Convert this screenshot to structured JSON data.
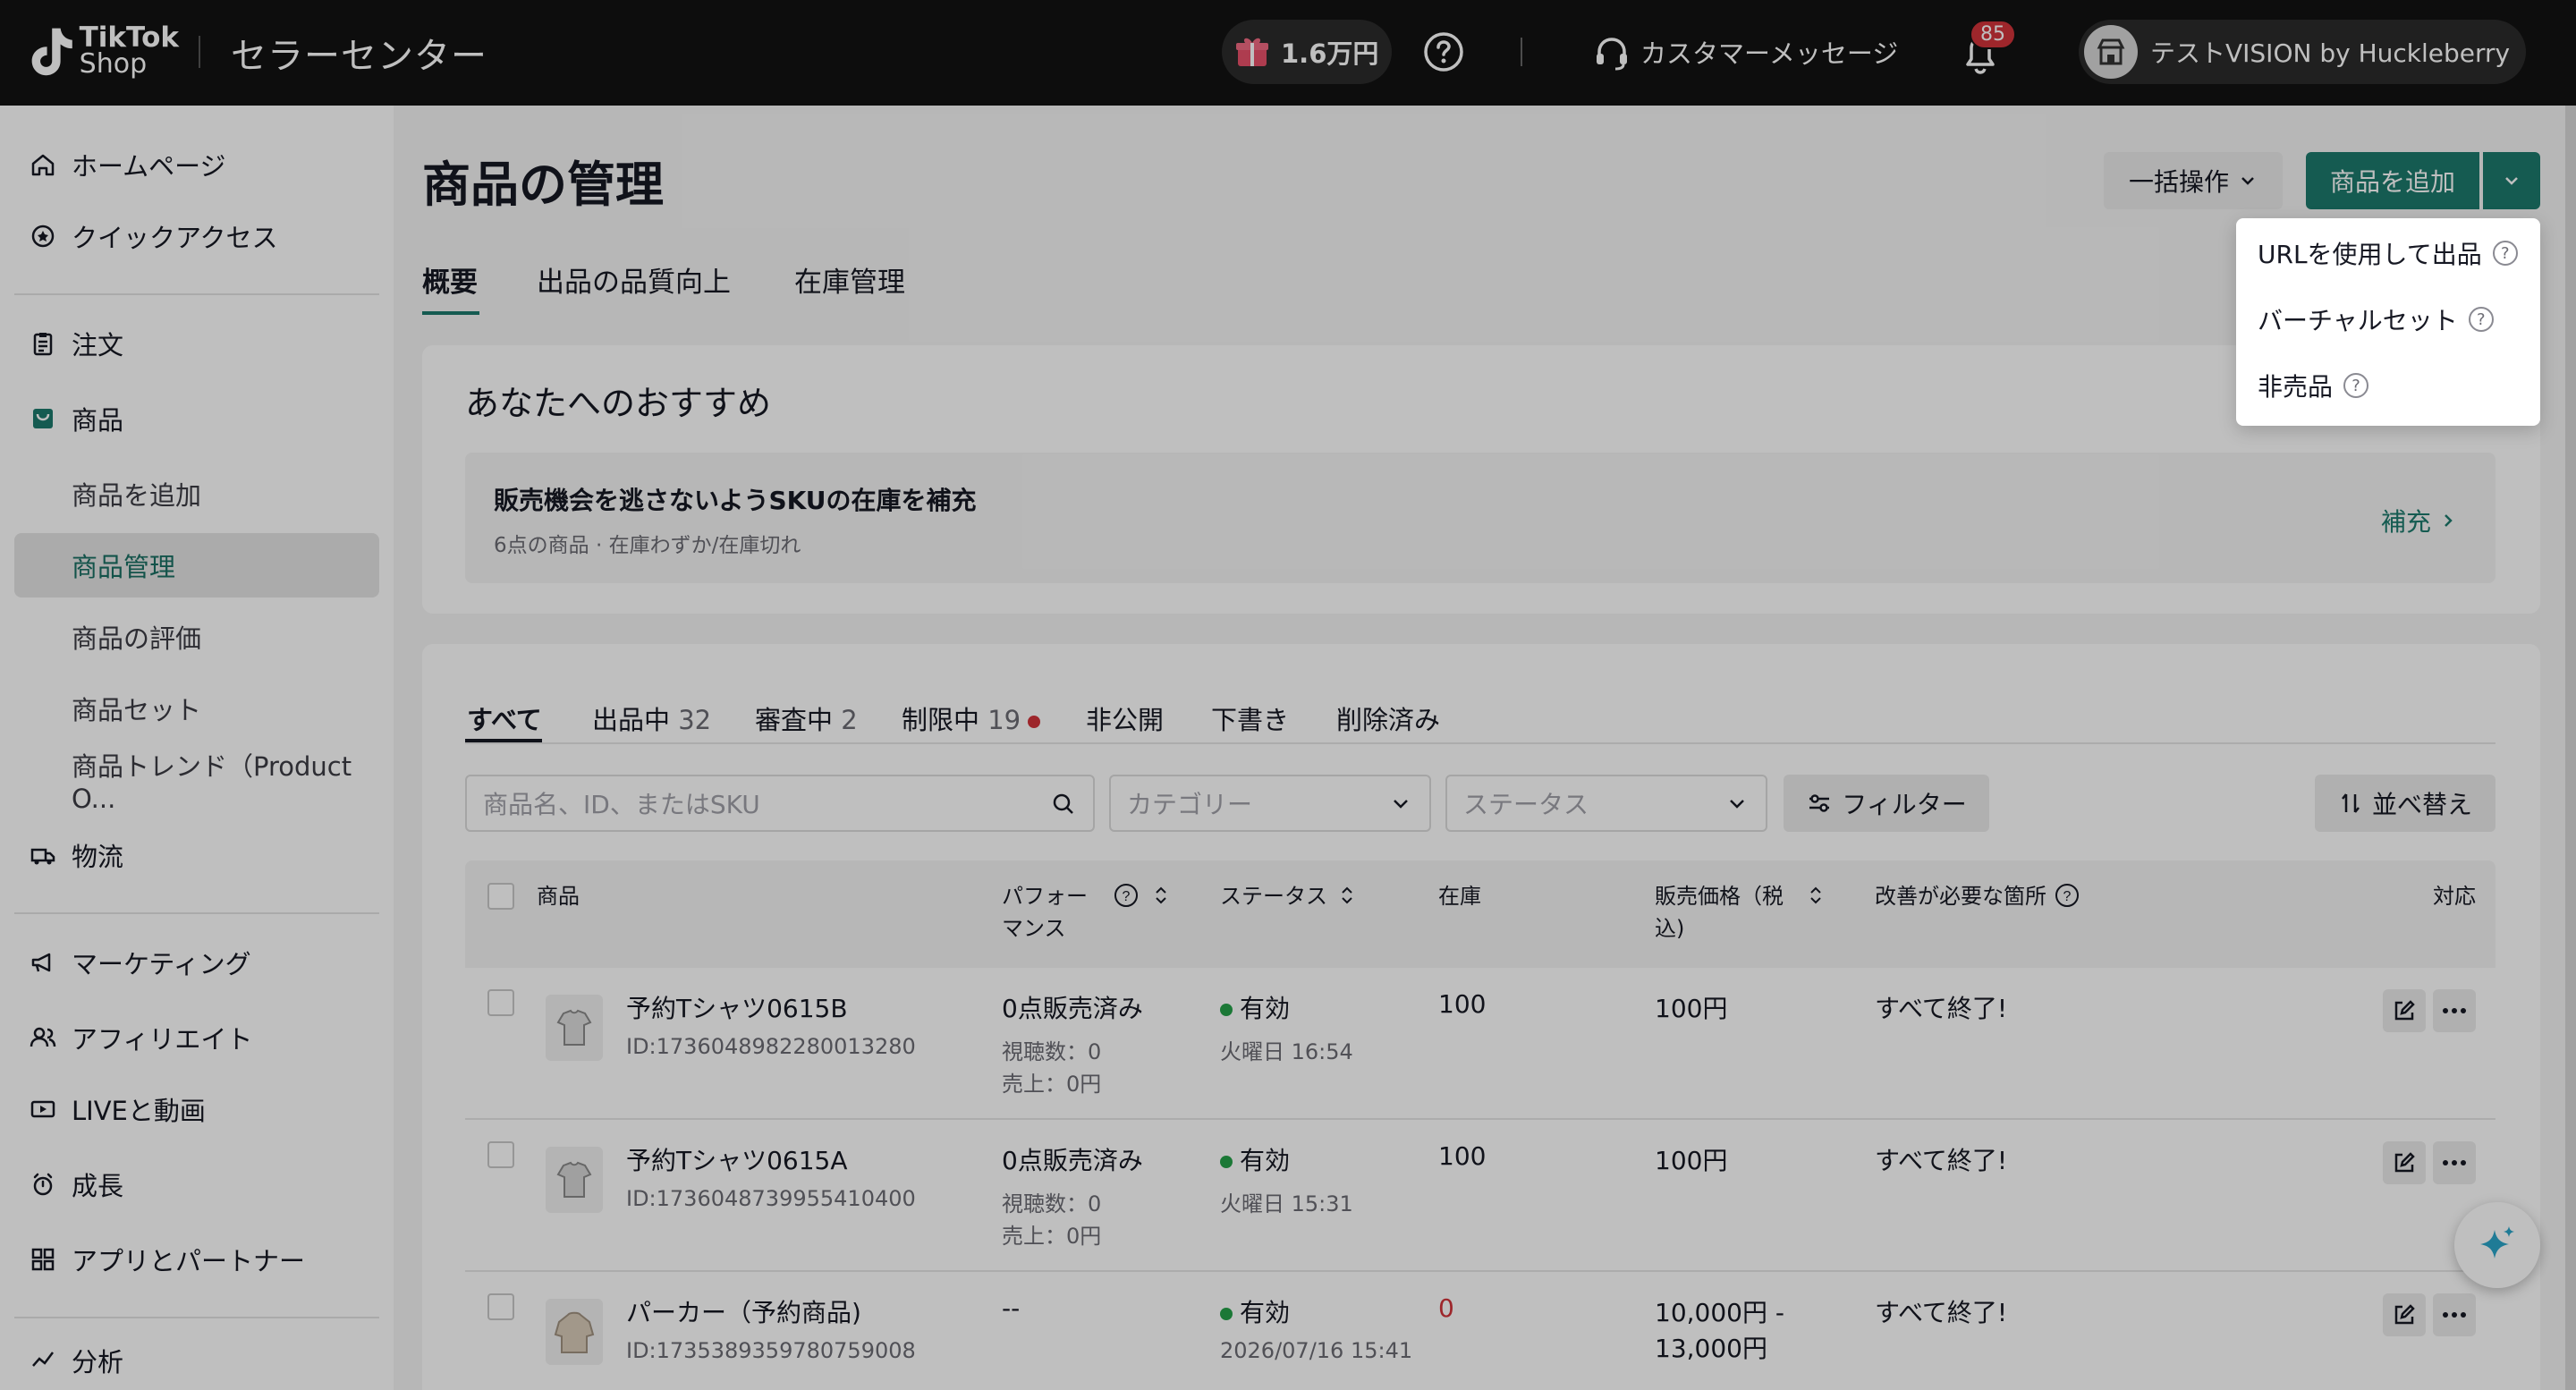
{
  "header": {
    "logo_line1": "TikTok",
    "logo_line2": "Shop",
    "brand": "セラーセンター",
    "credit": "1.6万円",
    "customer_message": "カスタマーメッセージ",
    "notification_count": "85",
    "account_name": "テストVISION by Huckleberry"
  },
  "sidebar": {
    "items": [
      {
        "label": "ホームページ",
        "icon": "home-icon"
      },
      {
        "label": "クイックアクセス",
        "icon": "star-icon"
      },
      {
        "label": "注文",
        "icon": "clipboard-icon"
      },
      {
        "label": "商品",
        "icon": "product-icon"
      },
      {
        "label": "商品を追加"
      },
      {
        "label": "商品管理"
      },
      {
        "label": "商品の評価"
      },
      {
        "label": "商品セット"
      },
      {
        "label": "商品トレンド（Product O..."
      },
      {
        "label": "物流",
        "icon": "truck-icon"
      },
      {
        "label": "マーケティング",
        "icon": "megaphone-icon"
      },
      {
        "label": "アフィリエイト",
        "icon": "users-icon"
      },
      {
        "label": "LIVEと動画",
        "icon": "video-icon"
      },
      {
        "label": "成長",
        "icon": "growth-icon"
      },
      {
        "label": "アプリとパートナー",
        "icon": "apps-icon"
      },
      {
        "label": "分析",
        "icon": "chart-icon"
      }
    ]
  },
  "page": {
    "title": "商品の管理",
    "bulk_label": "一括操作",
    "add_label": "商品を追加",
    "tabs": [
      "概要",
      "出品の品質向上",
      "在庫管理"
    ]
  },
  "add_menu": {
    "items": [
      "URLを使用して出品",
      "バーチャルセット",
      "非売品"
    ]
  },
  "recommend": {
    "title": "あなたへのおすすめ",
    "heading": "販売機会を逃さないようSKUの在庫を補充",
    "sub": "6点の商品 · 在庫わずか/在庫切れ",
    "link": "補充"
  },
  "filter_tabs": [
    {
      "label": "すべて",
      "count": ""
    },
    {
      "label": "出品中",
      "count": "32"
    },
    {
      "label": "審査中",
      "count": "2"
    },
    {
      "label": "制限中",
      "count": "19"
    },
    {
      "label": "非公開",
      "count": ""
    },
    {
      "label": "下書き",
      "count": ""
    },
    {
      "label": "削除済み",
      "count": ""
    }
  ],
  "filters": {
    "search_placeholder": "商品名、ID、またはSKU",
    "category_placeholder": "カテゴリー",
    "status_placeholder": "ステータス",
    "filter_label": "フィルター",
    "sort_label": "並べ替え"
  },
  "table": {
    "headers": {
      "product": "商品",
      "performance_1": "パフォー",
      "performance_2": "マンス",
      "status": "ステータス",
      "stock": "在庫",
      "price_1": "販売価格（税",
      "price_2": "込)",
      "improve": "改善が必要な箇所",
      "action": "対応"
    },
    "rows": [
      {
        "name": "予約Tシャツ0615B",
        "id": "ID:1736048982280013280",
        "perf": "0点販売済み",
        "views": "視聴数：0",
        "sales": "売上：0円",
        "status": "有効",
        "date": "火曜日 16:54",
        "stock": "100",
        "price1": "100円",
        "price2": "",
        "improve": "すべて終了!"
      },
      {
        "name": "予約Tシャツ0615A",
        "id": "ID:1736048739955410400",
        "perf": "0点販売済み",
        "views": "視聴数：0",
        "sales": "売上：0円",
        "status": "有効",
        "date": "火曜日 15:31",
        "stock": "100",
        "price1": "100円",
        "price2": "",
        "improve": "すべて終了!"
      },
      {
        "name": "パーカー（予約商品)",
        "id": "ID:1735389359780759008",
        "perf": "--",
        "views": "",
        "sales": "",
        "status": "有効",
        "date": "2026/07/16 15:41",
        "stock": "0",
        "price1": "10,000円 -",
        "price2": "13,000円",
        "improve": "すべて終了!"
      }
    ]
  },
  "colors": {
    "accent": "#1d7a6d",
    "danger": "#d2333a",
    "active_status": "#24a148"
  }
}
